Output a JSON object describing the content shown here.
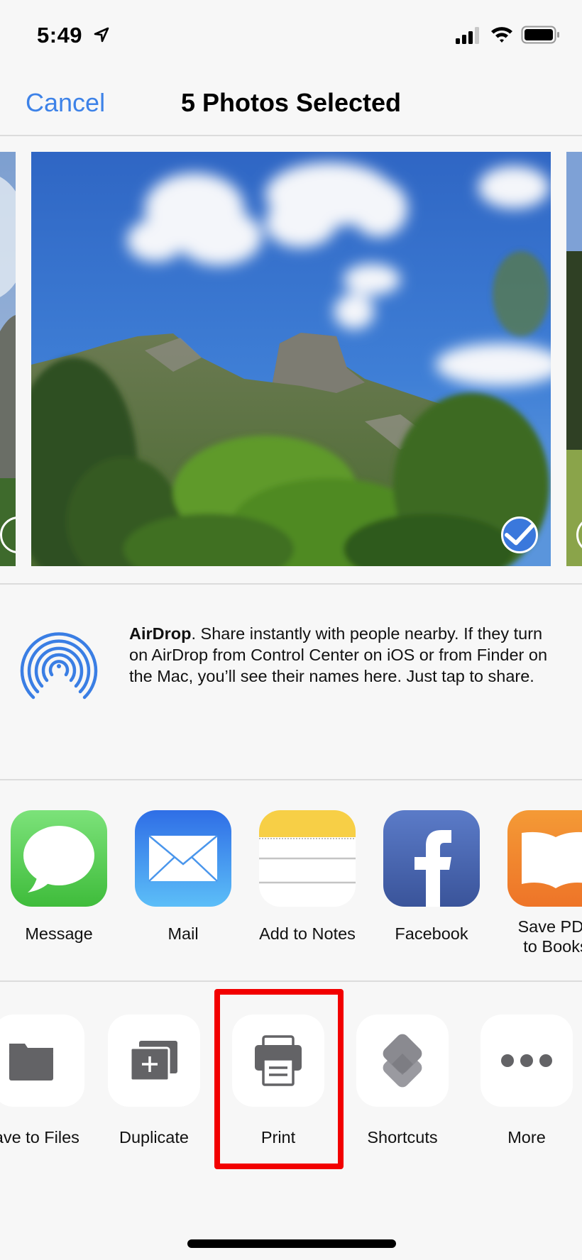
{
  "status_bar": {
    "time": "5:49",
    "icons": [
      "location-arrow-icon",
      "cellular-signal-icon",
      "wifi-icon",
      "battery-icon"
    ]
  },
  "nav": {
    "cancel_label": "Cancel",
    "title": "5 Photos Selected"
  },
  "carousel": {
    "selected_count": 5,
    "photos": [
      {
        "position": "previous",
        "selected": true
      },
      {
        "position": "current",
        "selected": true
      },
      {
        "position": "next",
        "selected": true
      }
    ]
  },
  "airdrop": {
    "title": "AirDrop",
    "description": ". Share instantly with people nearby. If they turn on AirDrop from Control Center on iOS or from Finder on the Mac, you’ll see their names here. Just tap to share."
  },
  "share_apps": [
    {
      "label": "Message",
      "icon": "messages-app-icon"
    },
    {
      "label": "Mail",
      "icon": "mail-app-icon"
    },
    {
      "label": "Add to Notes",
      "icon": "notes-app-icon"
    },
    {
      "label": "Facebook",
      "icon": "facebook-app-icon"
    },
    {
      "label": "Save PDF to Books",
      "label_line1": "Save PDF",
      "label_line2": "to Books",
      "icon": "books-app-icon"
    }
  ],
  "actions": [
    {
      "label": "Save to Files",
      "icon": "folder-icon"
    },
    {
      "label": "Duplicate",
      "icon": "duplicate-icon"
    },
    {
      "label": "Print",
      "icon": "printer-icon",
      "highlighted": true
    },
    {
      "label": "Shortcuts",
      "icon": "shortcuts-icon"
    },
    {
      "label": "More",
      "icon": "more-icon"
    }
  ],
  "colors": {
    "accent": "#3d82e8",
    "highlight": "#f20000",
    "background": "#f7f7f7",
    "action_icon_gray": "#636366"
  }
}
